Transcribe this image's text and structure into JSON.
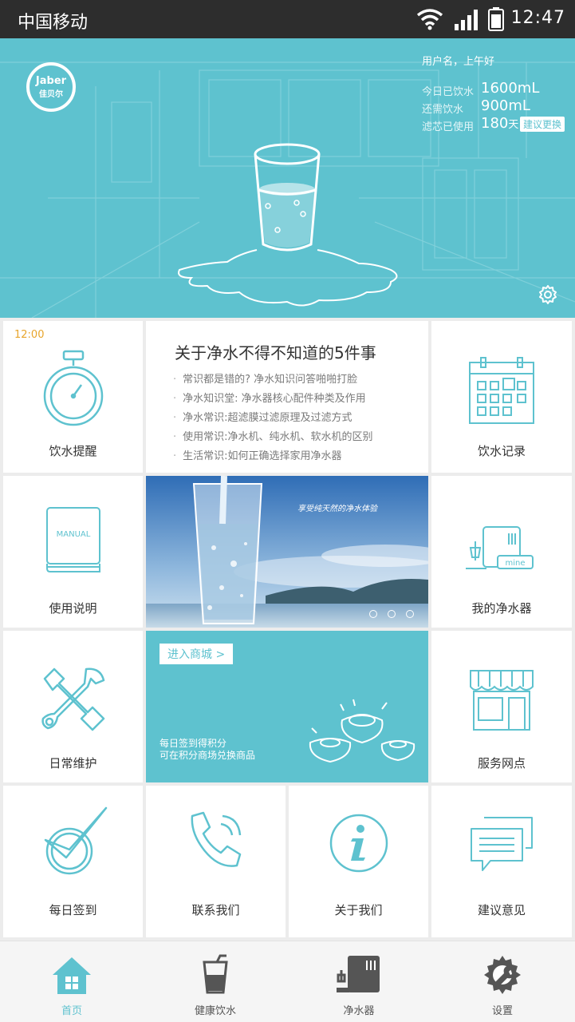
{
  "status_bar": {
    "carrier": "中国移动",
    "time": "12:47"
  },
  "header": {
    "logo_text": "Jaber",
    "logo_sub": "佳贝尔",
    "greeting": "用户名，上午好",
    "stats": [
      {
        "label": "今日已饮水",
        "value": "1600mL",
        "unit": ""
      },
      {
        "label": "还需饮水",
        "value": "900mL",
        "unit": ""
      },
      {
        "label": "滤芯已使用",
        "value": "180",
        "unit": "天"
      }
    ],
    "replace_button": "建议更换",
    "accent": "#5ec2cf"
  },
  "grid": {
    "reminder_time": "12:00",
    "drink_reminder": "饮水提醒",
    "drink_record": "饮水记录",
    "manual": "使用说明",
    "manual_cover_text": "MANUAL",
    "my_purifier": "我的净水器",
    "my_purifier_tag": "mine",
    "maintenance": "日常维护",
    "service_points": "服务网点",
    "checkin": "每日签到",
    "contact": "联系我们",
    "about": "关于我们",
    "feedback": "建议意见"
  },
  "article": {
    "title": "关于净水不得不知道的5件事",
    "items": [
      "常识都是错的? 净水知识问答啪啪打脸",
      "净水知识堂: 净水器核心配件种类及作用",
      "净水常识:超滤膜过滤原理及过滤方式",
      "使用常识:净水机、纯水机、软水机的区别",
      "生活常识:如何正确选择家用净水器"
    ]
  },
  "banner": {
    "slogan": "享受纯天然的净水体验"
  },
  "mall": {
    "enter": "进入商城 >",
    "line1": "每日签到得积分",
    "line2": "可在积分商场兑换商品"
  },
  "nav": [
    {
      "label": "首页",
      "icon": "home-icon",
      "active": true
    },
    {
      "label": "健康饮水",
      "icon": "cup-icon",
      "active": false
    },
    {
      "label": "净水器",
      "icon": "purifier-icon",
      "active": false
    },
    {
      "label": "设置",
      "icon": "settings-icon",
      "active": false
    }
  ]
}
